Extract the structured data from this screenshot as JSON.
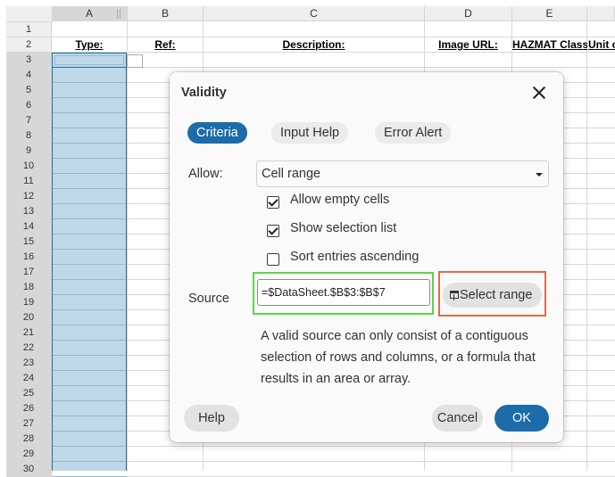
{
  "sheet": {
    "columns": [
      {
        "letter": "A",
        "selected": true
      },
      {
        "letter": "B",
        "selected": false
      },
      {
        "letter": "C",
        "selected": false
      },
      {
        "letter": "D",
        "selected": false
      },
      {
        "letter": "E",
        "selected": false
      }
    ],
    "rows": [
      "1",
      "2",
      "3",
      "4",
      "5",
      "6",
      "7",
      "8",
      "9",
      "10",
      "11",
      "12",
      "13",
      "14",
      "15",
      "16",
      "17",
      "18",
      "19",
      "20",
      "21",
      "22",
      "23",
      "24",
      "25",
      "26",
      "27",
      "28",
      "29",
      "30"
    ],
    "header_row": {
      "type": "Type:",
      "ref": "Ref:",
      "description": "Description:",
      "image_url": "Image URL:",
      "hazmat": "HAZMAT Class:",
      "unit": "Unit o"
    },
    "selection_color": "#bfd8e7"
  },
  "dialog": {
    "title": "Validity",
    "tabs": [
      {
        "label": "Criteria",
        "active": true
      },
      {
        "label": "Input Help",
        "active": false
      },
      {
        "label": "Error Alert",
        "active": false
      }
    ],
    "allow": {
      "label": "Allow:",
      "value": "Cell range"
    },
    "options": {
      "allow_empty": {
        "label": "Allow empty cells",
        "checked": true
      },
      "show_list": {
        "label": "Show selection list",
        "checked": true
      },
      "sort_asc": {
        "label": "Sort entries ascending",
        "checked": false
      }
    },
    "source": {
      "label": "Source",
      "value": "=$DataSheet.$B$3:$B$7"
    },
    "select_range_label": "Select range",
    "help_text": "A valid source can only consist of a contiguous selection of rows and columns, or a formula that results in an area or array.",
    "buttons": {
      "help": "Help",
      "cancel": "Cancel",
      "ok": "OK"
    },
    "accent_color": "#1b6ca8"
  }
}
